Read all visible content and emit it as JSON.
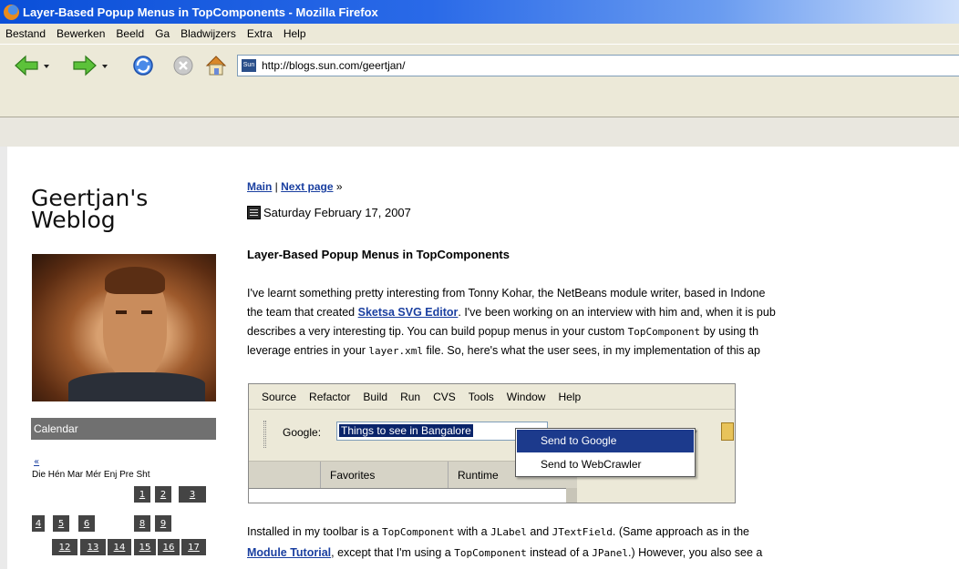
{
  "window": {
    "title": "Layer-Based Popup Menus in TopComponents - Mozilla Firefox"
  },
  "menubar": {
    "items": [
      "Bestand",
      "Bewerken",
      "Beeld",
      "Ga",
      "Bladwijzers",
      "Extra",
      "Help"
    ]
  },
  "navbar": {
    "url": "http://blogs.sun.com/geertjan/",
    "favicon_text": "Sun"
  },
  "sidebar": {
    "blog_title_line1": "Geertjan's",
    "blog_title_line2": "Weblog",
    "calendar_label": "Calendar",
    "calendar_prev": "«",
    "calendar_days": "Die Hén Mar Mér Enj Pre Sht",
    "calendar_cells": [
      "1",
      "2",
      "3",
      "4",
      "5",
      "6",
      "8",
      "9",
      "12",
      "13",
      "14",
      "15",
      "16",
      "17"
    ]
  },
  "post": {
    "nav_main": "Main",
    "nav_sep": " | ",
    "nav_next": "Next page",
    "nav_arrow": " »",
    "date": "Saturday February 17, 2007",
    "title": "Layer-Based Popup Menus in TopComponents",
    "p1_l1": "I've learnt something pretty interesting from Tonny Kohar, the NetBeans module writer, based in Indone",
    "p1_l2_a": "the team that created ",
    "p1_l2_link": "Sketsa SVG Editor",
    "p1_l2_b": ". I've been working on an interview with him and, when it is pub",
    "p1_l3_a": "describes a very interesting tip. You can build popup menus in your custom ",
    "p1_l3_code": "TopComponent",
    "p1_l3_b": " by using th",
    "p1_l4_a": "leverage entries in your ",
    "p1_l4_code": "layer.xml",
    "p1_l4_b": " file. So, here's what the user sees, in my implementation of this ap",
    "p2_l1_a": "Installed in my toolbar is a ",
    "p2_l1_code1": "TopComponent",
    "p2_l1_b": " with a ",
    "p2_l1_code2": "JLabel",
    "p2_l1_c": " and ",
    "p2_l1_code3": "JTextField",
    "p2_l1_d": ". (Same approach as in the",
    "p2_l2_link": "Module Tutorial",
    "p2_l2_a": ", except that I'm using a ",
    "p2_l2_code1": "TopComponent",
    "p2_l2_b": " instead of a ",
    "p2_l2_code2": "JPanel",
    "p2_l2_c": ".) However, you also see a"
  },
  "ide_shot": {
    "menu": [
      "Source",
      "Refactor",
      "Build",
      "Run",
      "CVS",
      "Tools",
      "Window",
      "Help"
    ],
    "google_label": "Google:",
    "google_value": "Things to see in Bangalore",
    "popup_items": [
      "Send to Google",
      "Send to WebCrawler"
    ],
    "tabs": [
      "Favorites",
      "Runtime"
    ]
  }
}
